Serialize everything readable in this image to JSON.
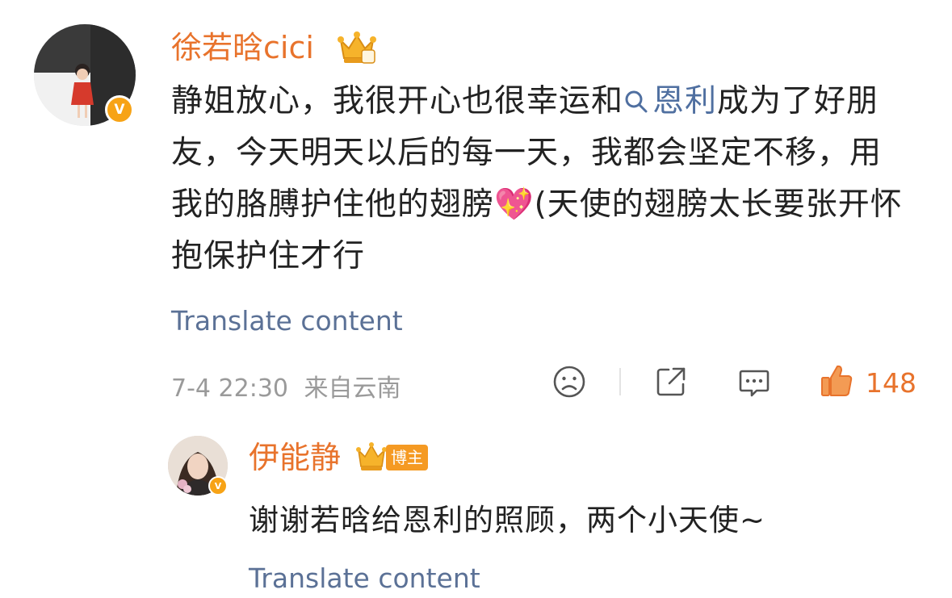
{
  "comment": {
    "username": "徐若晗cici",
    "text_before_topic": "静姐放心，我很开心也很幸运和",
    "topic": "恩利",
    "text_after_topic": "成为了好朋友，今天明天以后的每一天，我都会坚定不移，用我的胳膊护住他的翅膀",
    "emoji": "💖",
    "text_after_emoji": "(天使的翅膀太长要张开怀抱保护住才行",
    "translate_label": "Translate content",
    "timestamp": "7-4 22:30",
    "location": "来自云南",
    "like_count": "148",
    "verified_mark": "V"
  },
  "reply": {
    "username": "伊能静",
    "blogger_badge": "博主",
    "text": "谢谢若晗给恩利的照顾，两个小天使~",
    "translate_label": "Translate content",
    "verified_mark": "V"
  },
  "colors": {
    "accent_orange": "#e8732c",
    "link_blue": "#5b7196",
    "meta_gray": "#9a9a9a"
  },
  "icons": [
    "dislike-face-icon",
    "share-icon",
    "comment-icon",
    "thumbs-up-icon",
    "search-icon",
    "crown-icon",
    "verified-icon"
  ]
}
